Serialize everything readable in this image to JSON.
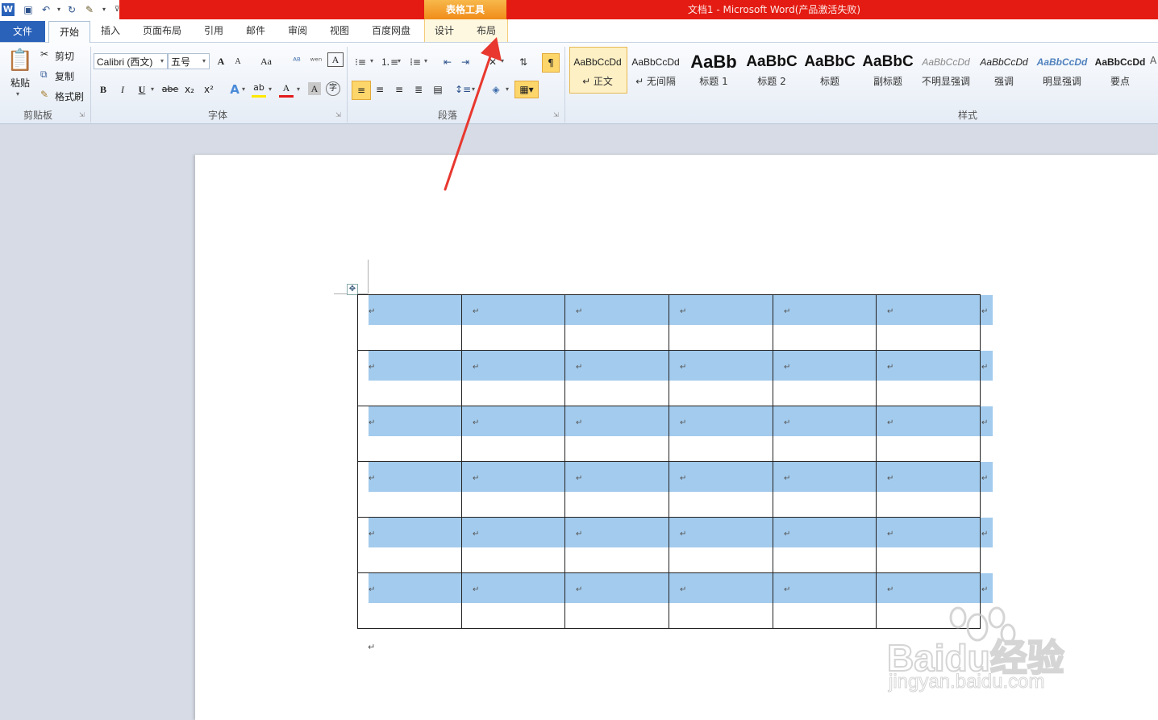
{
  "title_bar": {
    "window_title": "文档1 - Microsoft Word(产品激活失败)",
    "context_tab_group": "表格工具"
  },
  "quick_access": [
    "word-icon",
    "save-icon",
    "undo-icon",
    "redo-icon",
    "format-painter-icon",
    "customize-icon"
  ],
  "tabs": {
    "file": "文件",
    "home": "开始",
    "insert": "插入",
    "page_layout": "页面布局",
    "references": "引用",
    "mailings": "邮件",
    "review": "审阅",
    "view": "视图",
    "baidu": "百度网盘",
    "design": "设计",
    "layout": "布局"
  },
  "clipboard": {
    "paste": "粘贴",
    "cut": "剪切",
    "copy": "复制",
    "format_painter": "格式刷",
    "group": "剪贴板"
  },
  "font": {
    "font_name": "Calibri (西文)",
    "font_size": "五号",
    "group": "字体",
    "grow": "A",
    "shrink": "A",
    "change_case": "Aa",
    "bold": "B",
    "italic": "I",
    "underline": "U",
    "strike": "abe",
    "subscript": "x₂",
    "superscript": "x²",
    "font_color": "A",
    "char_shading": "A",
    "enclose": "字",
    "char_border": "A"
  },
  "paragraph": {
    "group": "段落"
  },
  "styles": {
    "group": "样式",
    "items": [
      {
        "sample": "AaBbCcDd",
        "name": "↵ 正文"
      },
      {
        "sample": "AaBbCcDd",
        "name": "↵ 无间隔"
      },
      {
        "sample": "AaBb",
        "name": "标题 1"
      },
      {
        "sample": "AaBbC",
        "name": "标题 2"
      },
      {
        "sample": "AaBbC",
        "name": "标题"
      },
      {
        "sample": "AaBbC",
        "name": "副标题"
      },
      {
        "sample": "AaBbCcDd",
        "name": "不明显强调"
      },
      {
        "sample": "AaBbCcDd",
        "name": "强调"
      },
      {
        "sample": "AaBbCcDd",
        "name": "明显强调"
      },
      {
        "sample": "AaBbCcDd",
        "name": "要点"
      }
    ]
  },
  "document": {
    "table_rows": 6,
    "table_cols": 6,
    "cell_mark": "↵",
    "paragraph_mark": "↵",
    "selection_color": "#a3cbed"
  },
  "colors": {
    "title_red": "#e41b12",
    "file_tab": "#2a62b9",
    "context_tab": "#f08c1a",
    "arrow": "#e8382f"
  },
  "watermark": {
    "text": "Baidu经验",
    "url": "jingyan.baidu.com"
  }
}
